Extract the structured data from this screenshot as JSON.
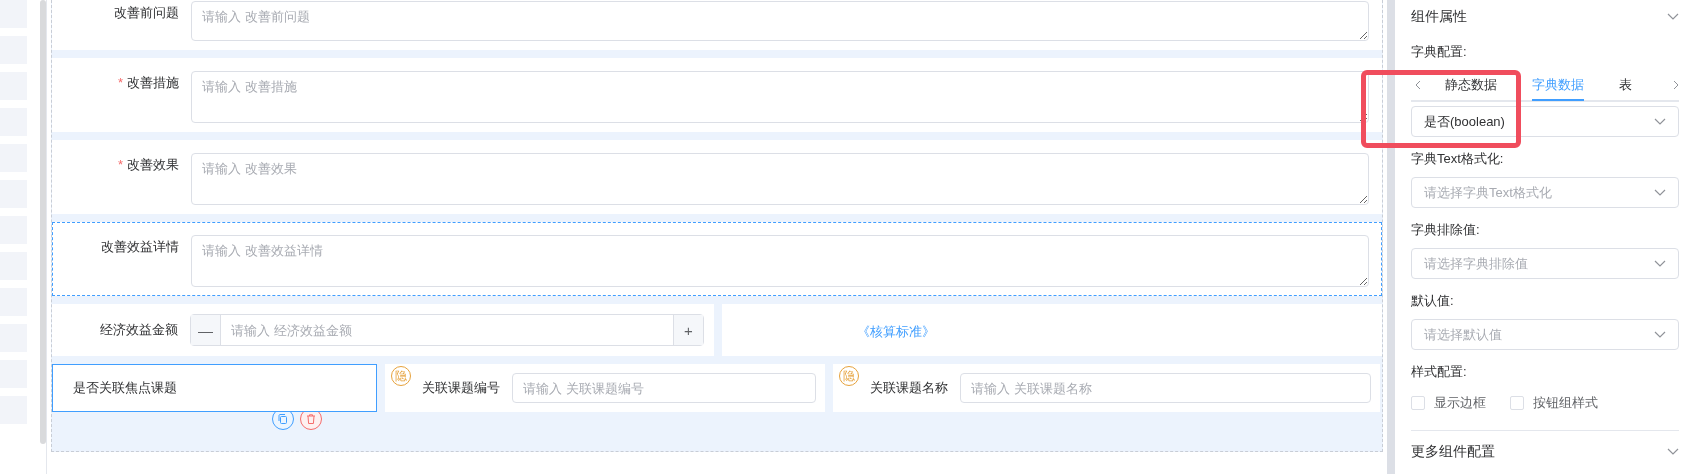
{
  "form_rows": [
    {
      "label": "改善前问题",
      "placeholder": "请输入 改善前问题",
      "selected": false
    },
    {
      "label": "改善措施",
      "required_mark": "*",
      "placeholder": "请输入 改善措施",
      "selected": false
    },
    {
      "label": "改善效果",
      "required_mark": "*",
      "placeholder": "请输入 改善效果",
      "selected": false
    },
    {
      "label": "改善效益详情",
      "placeholder": "请输入 改善效益详情",
      "selected": true
    }
  ],
  "amount_field": {
    "label": "经济效益金额",
    "placeholder": "请输入 经济效益金额",
    "minus": "—",
    "plus": "+"
  },
  "link": "《核算标准》",
  "bottom_row": {
    "cells": [
      {
        "kind": "text",
        "label": "是否关联焦点课题",
        "selected": true
      },
      {
        "kind": "input",
        "badge": "隐",
        "label": "关联课题编号",
        "placeholder": "请输入 关联课题编号",
        "selected": false
      },
      {
        "kind": "input",
        "badge": "隐",
        "label": "关联课题名称",
        "placeholder": "请输入 关联课题名称",
        "selected": false
      }
    ]
  },
  "panel": {
    "title": "组件属性",
    "dict_label": "字典配置:",
    "tabs": [
      {
        "label": "静态数据",
        "selected": false
      },
      {
        "label": "字典数据",
        "selected": true
      },
      {
        "label": "表",
        "selected": false
      }
    ],
    "dict_value": "是否(boolean)",
    "fields": [
      {
        "label": "字典Text格式化:",
        "placeholder": "请选择字典Text格式化"
      },
      {
        "label": "字典排除值:",
        "placeholder": "请选择字典排除值"
      },
      {
        "label": "默认值:",
        "placeholder": "请选择默认值"
      }
    ],
    "style_label": "样式配置:",
    "checkboxes": [
      {
        "label": "显示边框",
        "checked": false
      },
      {
        "label": "按钮组样式",
        "checked": false
      }
    ],
    "more_title": "更多组件配置"
  }
}
